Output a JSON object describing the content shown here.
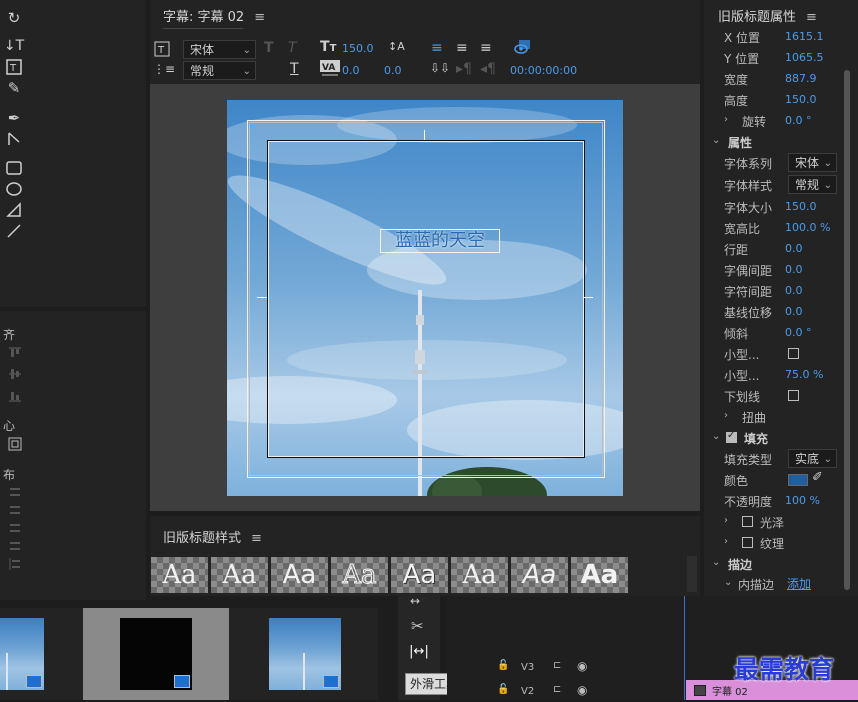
{
  "program_monitor": {
    "title": "字幕: 字幕 02"
  },
  "title_properties": {
    "title": "旧版标题属性"
  },
  "title_styles": {
    "title": "旧版标题样式"
  },
  "toolbar": {
    "font_family": "宋体",
    "font_style": "常规",
    "font_size": "150.0",
    "leading": "0.0",
    "kerning": "0.0",
    "timecode": "00:00:00:00"
  },
  "left_panel": {
    "align_label": "齐",
    "center_label": "心",
    "distribute_label": "布"
  },
  "canvas": {
    "text": "蓝蓝的天空"
  },
  "properties": [
    {
      "label": "X 位置",
      "value": "1615.1"
    },
    {
      "label": "Y 位置",
      "value": "1065.5"
    },
    {
      "label": "宽度",
      "value": "887.9"
    },
    {
      "label": "高度",
      "value": "150.0"
    },
    {
      "label": "旋转",
      "value": "0.0 °"
    }
  ],
  "attributes": {
    "section": "属性",
    "font_family_label": "字体系列",
    "font_family_value": "宋体",
    "font_style_label": "字体样式",
    "font_style_value": "常规",
    "font_size_label": "字体大小",
    "font_size_value": "150.0",
    "aspect_label": "宽高比",
    "aspect_value": "100.0 %",
    "leading_label": "行距",
    "leading_value": "0.0",
    "kerning_label": "字偶间距",
    "kerning_value": "0.0",
    "tracking_label": "字符间距",
    "tracking_value": "0.0",
    "baseline_label": "基线位移",
    "baseline_value": "0.0",
    "slant_label": "倾斜",
    "slant_value": "0.0 °",
    "smallcaps_label": "小型...",
    "smallcaps_size_label": "小型...",
    "smallcaps_size_value": "75.0 %",
    "underline_label": "下划线",
    "distort_label": "扭曲"
  },
  "fill": {
    "section": "填充",
    "type_label": "填充类型",
    "type_value": "实底",
    "color_label": "颜色",
    "color_hex": "#1f5fa0",
    "opacity_label": "不透明度",
    "opacity_value": "100 %",
    "sheen_label": "光泽",
    "texture_label": "纹理"
  },
  "stroke": {
    "section": "描边",
    "inner_label": "内描边",
    "add_label": "添加"
  },
  "styles": [
    "Aa",
    "Aa",
    "Aa",
    "Aa",
    "Aa",
    "Aa",
    "Aa",
    "Aa"
  ],
  "timeline": {
    "tracks": [
      "V3",
      "V2"
    ],
    "clip_label": "字幕 02",
    "clip_color": "#d98fd9",
    "tooltip": "外滑工具 (Y)"
  },
  "watermark": "最需教育"
}
